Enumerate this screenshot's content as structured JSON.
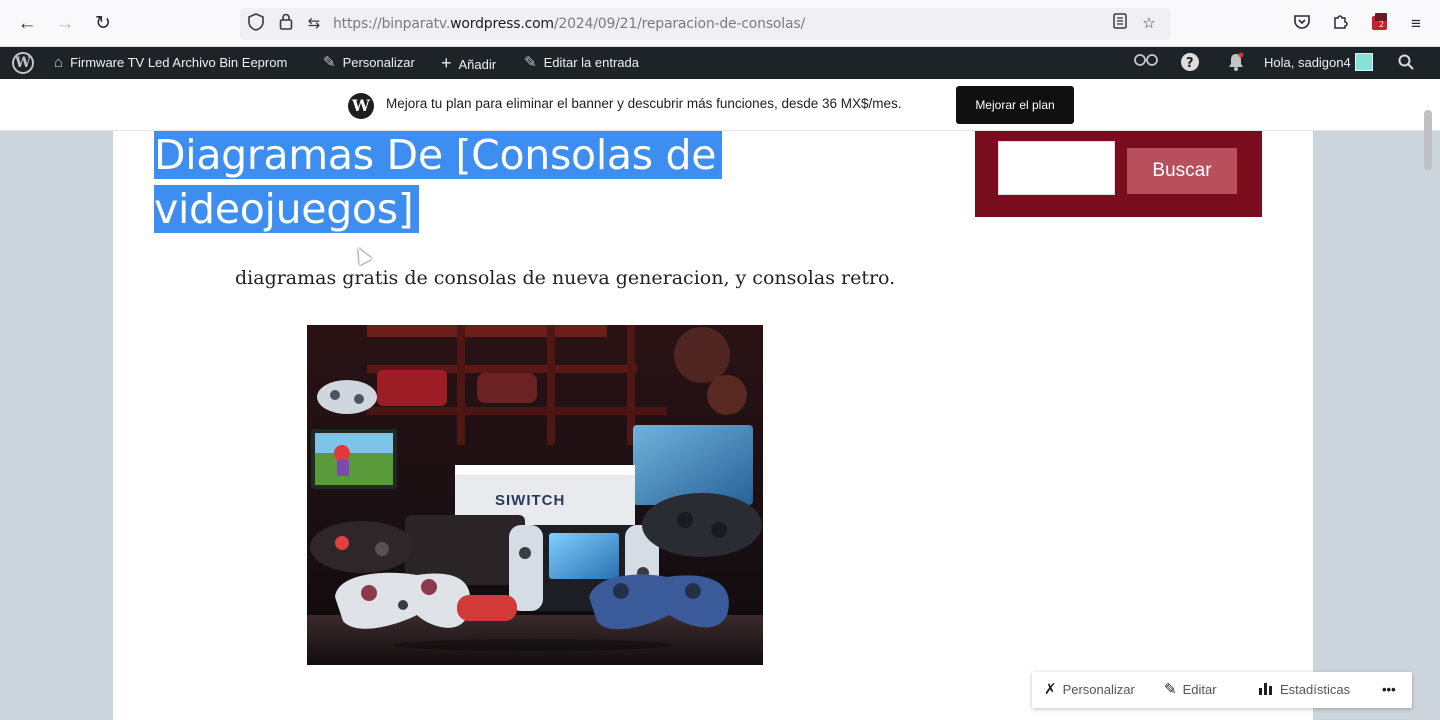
{
  "browser": {
    "back_icon": "arrow-left-icon",
    "forward_icon": "arrow-right-icon",
    "reload_icon": "reload-icon",
    "url_prefix": "https://binparatv.",
    "url_domain": "wordpress.com",
    "url_path": "/2024/09/21/reparacion-de-consolas/",
    "icons": [
      "shield-icon",
      "lock-icon",
      "permissions-icon",
      "reader-view-icon",
      "bookmark-star-icon",
      "pocket-icon",
      "extensions-icon",
      "addon-icon",
      "menu-icon"
    ]
  },
  "admin_bar": {
    "site_name": "Firmware TV Led Archivo Bin Eeprom",
    "customize": "Personalizar",
    "add_new": "Añadir",
    "edit_post": "Editar la entrada",
    "greeting": "Hola, sadigon4"
  },
  "banner": {
    "text": "Mejora tu plan para eliminar el banner y descubrir más funciones, desde 36 MX$/mes.",
    "button": "Mejorar el plan"
  },
  "post": {
    "title": "Diagramas De [Consolas de videojuegos]",
    "excerpt": "diagramas gratis de consolas de nueva generacion, y consolas retro."
  },
  "sidebar": {
    "search_placeholder": "",
    "search_button": "Buscar"
  },
  "hero_image": {
    "console_label": "SIWITCH",
    "colors": {
      "bg": "#1a1112",
      "shelf": "#6b1e1a",
      "accent": "#e04040"
    }
  },
  "action_bar": {
    "customize": "Personalizar",
    "edit": "Editar",
    "stats": "Estadísticas",
    "more": "•••"
  },
  "colors": {
    "admin_bar": "#1d2327",
    "widget_bg": "#7a0d1d",
    "search_btn": "#b84f5c",
    "selection": "#3d8ef0",
    "page_bg": "#ccd5dc"
  }
}
